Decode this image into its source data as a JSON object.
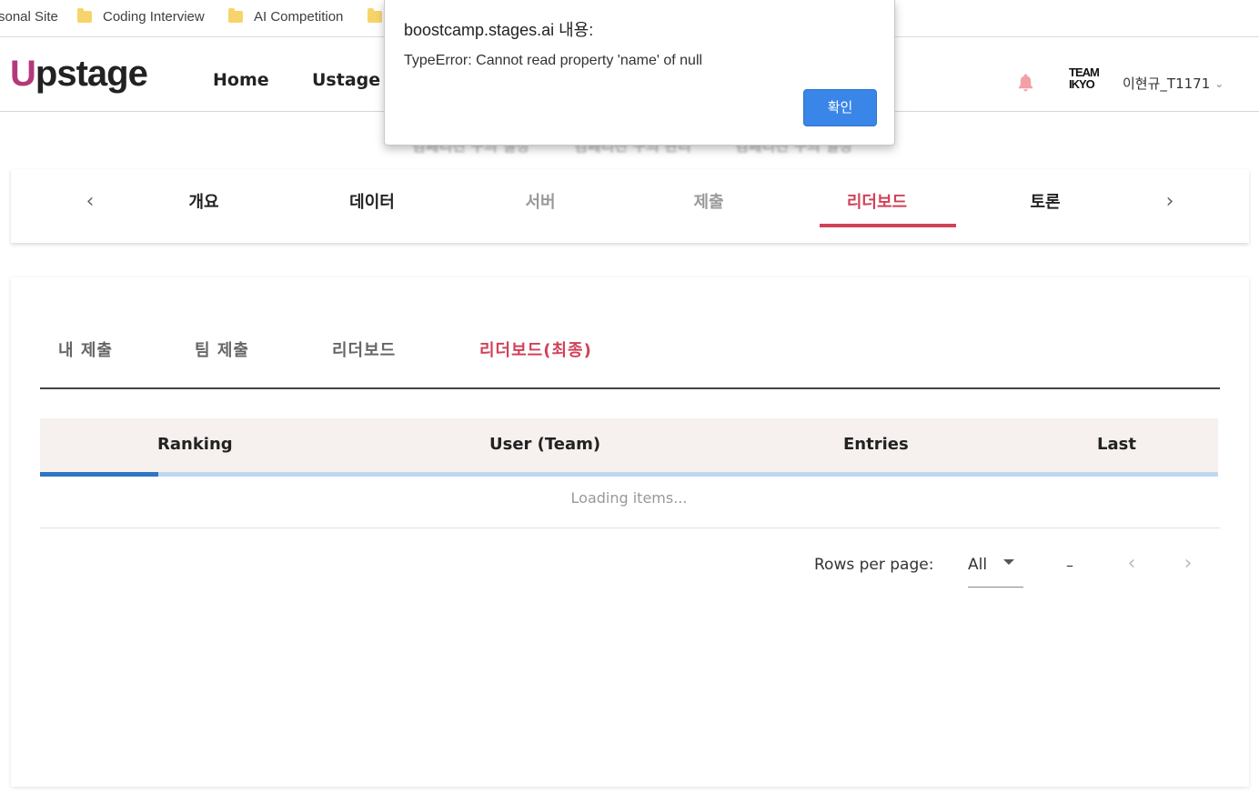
{
  "bookmarks": [
    {
      "label": "sonal Site"
    },
    {
      "label": "Coding Interview"
    },
    {
      "label": "AI Competition"
    },
    {
      "label": ""
    }
  ],
  "header": {
    "logo": "Upstage",
    "logo_first_letter": "U",
    "logo_rest": "pstage",
    "nav": [
      "Home",
      "Ustage"
    ],
    "team_logo_line1": "TEAM",
    "team_logo_line2": "IKYO",
    "username": "이현규_T1171",
    "username_chevron": "⌄"
  },
  "subnav": {
    "items": [
      "컴페티션 구의 질정",
      "컴페티션 구의 관리",
      "컴페티션 구의 일정"
    ]
  },
  "competition_tabs": {
    "prev": "‹",
    "next": "›",
    "items": [
      {
        "label": "개요",
        "state": "normal"
      },
      {
        "label": "데이터",
        "state": "normal"
      },
      {
        "label": "서버",
        "state": "disabled"
      },
      {
        "label": "제출",
        "state": "disabled"
      },
      {
        "label": "리더보드",
        "state": "active"
      },
      {
        "label": "토론",
        "state": "normal"
      }
    ]
  },
  "leaderboard": {
    "sub_tabs": [
      {
        "label": "내 제출",
        "active": false
      },
      {
        "label": "팀 제출",
        "active": false
      },
      {
        "label": "리더보드",
        "active": false
      },
      {
        "label": "리더보드(최종)",
        "active": true
      }
    ],
    "columns": [
      "Ranking",
      "User (Team)",
      "Entries",
      "Last"
    ],
    "loading_text": "Loading items...",
    "loading_progress": 0.1,
    "pagination": {
      "rows_per_page_label": "Rows per page:",
      "rows_per_page_value": "All",
      "range_text": "–",
      "prev": "‹",
      "next": "›"
    }
  },
  "alert": {
    "title": "boostcamp.stages.ai 내용:",
    "message": "TypeError: Cannot read property 'name' of null",
    "ok_label": "확인"
  },
  "colors": {
    "accent": "#d14158",
    "primary_blue": "#3a86e8",
    "progress_blue": "#2d74c4",
    "header_bg": "#f6f1ee"
  }
}
